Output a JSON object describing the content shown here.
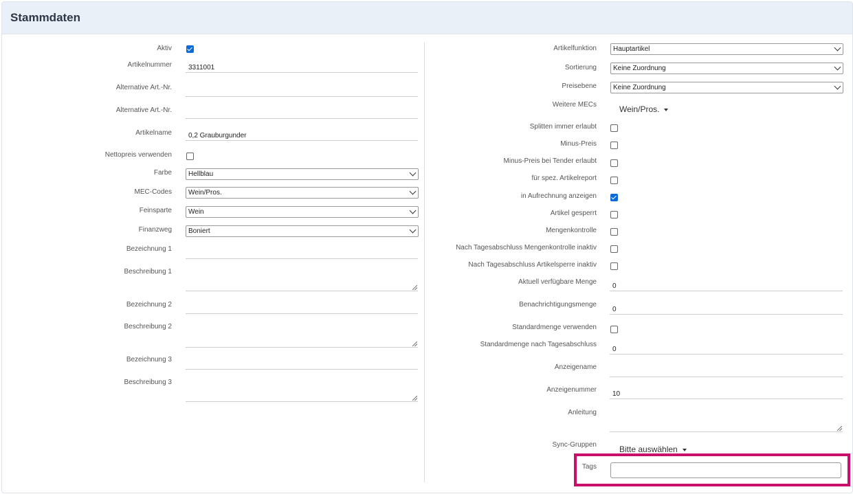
{
  "card": {
    "title": "Stammdaten"
  },
  "left": {
    "aktiv": {
      "label": "Aktiv",
      "checked": true
    },
    "artikelnummer": {
      "label": "Artikelnummer",
      "value": "3311001"
    },
    "alt1": {
      "label": "Alternative Art.-Nr.",
      "value": ""
    },
    "alt2": {
      "label": "Alternative Art.-Nr.",
      "value": ""
    },
    "artikelname": {
      "label": "Artikelname",
      "value": "0,2 Grauburgunder"
    },
    "nettopreis": {
      "label": "Nettopreis verwenden",
      "checked": false
    },
    "farbe": {
      "label": "Farbe",
      "value": "Hellblau"
    },
    "mec": {
      "label": "MEC-Codes",
      "value": "Wein/Pros."
    },
    "feinsparte": {
      "label": "Feinsparte",
      "value": "Wein"
    },
    "finanzweg": {
      "label": "Finanzweg",
      "value": "Boniert"
    },
    "bez1": {
      "label": "Bezeichnung 1",
      "value": ""
    },
    "besch1": {
      "label": "Beschreibung 1",
      "value": ""
    },
    "bez2": {
      "label": "Bezeichnung 2",
      "value": ""
    },
    "besch2": {
      "label": "Beschreibung 2",
      "value": ""
    },
    "bez3": {
      "label": "Bezeichnung 3",
      "value": ""
    },
    "besch3": {
      "label": "Beschreibung 3",
      "value": ""
    }
  },
  "right": {
    "artikelfunktion": {
      "label": "Artikelfunktion",
      "value": "Hauptartikel"
    },
    "sortierung": {
      "label": "Sortierung",
      "value": "Keine Zuordnung"
    },
    "preisebene": {
      "label": "Preisebene",
      "value": "Keine Zuordnung"
    },
    "weitere_mecs": {
      "label": "Weitere MECs",
      "value": "Wein/Pros."
    },
    "splitten": {
      "label": "Splitten immer erlaubt",
      "checked": false
    },
    "minus_preis": {
      "label": "Minus-Preis",
      "checked": false
    },
    "minus_tender": {
      "label": "Minus-Preis bei Tender erlaubt",
      "checked": false
    },
    "spez_report": {
      "label": "für spez. Artikelreport",
      "checked": false
    },
    "aufrechnung": {
      "label": "in Aufrechnung anzeigen",
      "checked": true
    },
    "gesperrt": {
      "label": "Artikel gesperrt",
      "checked": false
    },
    "mengenkontrolle": {
      "label": "Mengenkontrolle",
      "checked": false
    },
    "tag_mengen": {
      "label": "Nach Tagesabschluss Mengenkontrolle inaktiv",
      "checked": false
    },
    "tag_sperre": {
      "label": "Nach Tagesabschluss Artikelsperre inaktiv",
      "checked": false
    },
    "verfuegbar": {
      "label": "Aktuell verfügbare Menge",
      "value": "0"
    },
    "benachrichtigung": {
      "label": "Benachrichtigungsmenge",
      "value": "0"
    },
    "standardmenge_verw": {
      "label": "Standardmenge verwenden",
      "checked": false
    },
    "standardmenge_tag": {
      "label": "Standardmenge nach Tagesabschluss",
      "value": "0"
    },
    "anzeigename": {
      "label": "Anzeigename",
      "value": ""
    },
    "anzeigenummer": {
      "label": "Anzeigenummer",
      "value": "10"
    },
    "anleitung": {
      "label": "Anleitung",
      "value": ""
    },
    "sync": {
      "label": "Sync-Gruppen",
      "value": "Bitte auswählen"
    },
    "tags": {
      "label": "Tags",
      "value": ""
    }
  },
  "icons": {
    "checkbox_checked_color": "#0b6bd8",
    "highlight_color": "#c8106b"
  }
}
